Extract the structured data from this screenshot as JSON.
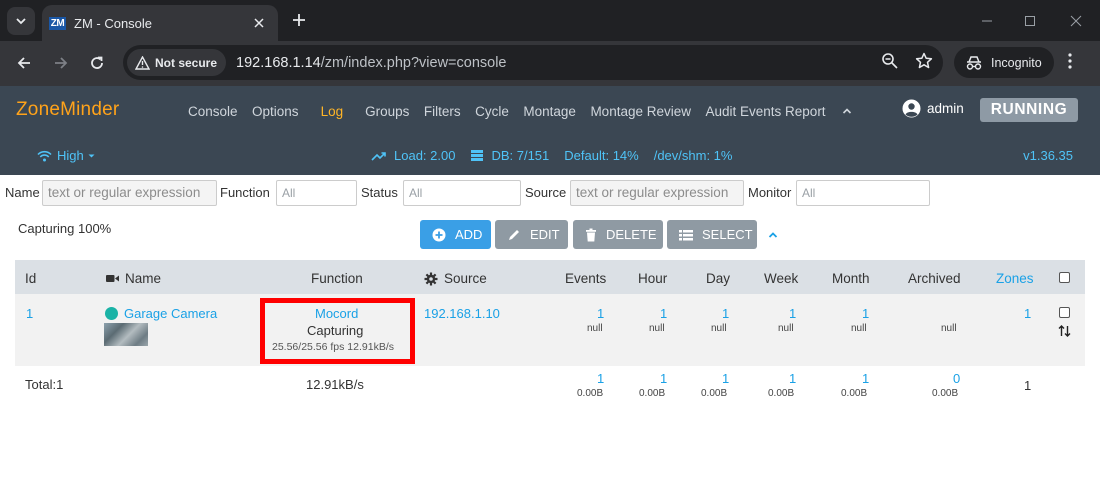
{
  "browser": {
    "tab_title": "ZM - Console",
    "favicon_text": "ZM",
    "security_chip": "Not secure",
    "url_host": "192.168.1.14",
    "url_path": "/zm/index.php?view=console",
    "profile_label": "Incognito"
  },
  "app": {
    "brand": "ZoneMinder",
    "menu": [
      {
        "label": "Console"
      },
      {
        "label": "Options"
      },
      {
        "label": "Log"
      },
      {
        "label": "Groups"
      },
      {
        "label": "Filters"
      },
      {
        "label": "Cycle"
      },
      {
        "label": "Montage"
      },
      {
        "label": "Montage Review"
      },
      {
        "label": "Audit Events Report"
      }
    ],
    "active_menu": "Log",
    "user": "admin",
    "state": "RUNNING",
    "bandwidth": "High",
    "load": "Load: 2.00",
    "db": "DB: 7/151",
    "storage": "Default: 14%",
    "shm": "/dev/shm: 1%",
    "version": "v1.36.35"
  },
  "filters": {
    "name_label": "Name",
    "name_placeholder": "text or regular expression",
    "function_label": "Function",
    "function_value": "All",
    "status_label": "Status",
    "status_value": "All",
    "source_label": "Source",
    "source_placeholder": "text or regular expression",
    "monitor_label": "Monitor",
    "monitor_value": "All"
  },
  "actions": {
    "capturing_summary": "Capturing 100%",
    "add": "ADD",
    "edit": "EDIT",
    "delete": "DELETE",
    "select": "SELECT"
  },
  "table": {
    "headers": {
      "id": "Id",
      "name": "Name",
      "function": "Function",
      "source": "Source",
      "events": "Events",
      "hour": "Hour",
      "day": "Day",
      "week": "Week",
      "month": "Month",
      "archived": "Archived",
      "zones": "Zones"
    },
    "rows": [
      {
        "id": "1",
        "name": "Garage Camera",
        "function": "Mocord",
        "status": "Capturing",
        "fps": "25.56/25.56 fps 12.91kB/s",
        "source": "192.168.1.10",
        "events": "1",
        "events_size": "null",
        "hour": "1",
        "hour_size": "null",
        "day": "1",
        "day_size": "null",
        "week": "1",
        "week_size": "null",
        "month": "1",
        "month_size": "null",
        "archived_size": "null",
        "zones": "1"
      }
    ],
    "totals": {
      "label": "Total:1",
      "bandwidth": "12.91kB/s",
      "events": "1",
      "events_size": "0.00B",
      "hour": "1",
      "hour_size": "0.00B",
      "day": "1",
      "day_size": "0.00B",
      "week": "1",
      "week_size": "0.00B",
      "month": "1",
      "month_size": "0.00B",
      "archived": "0",
      "archived_size": "0.00B",
      "zones": "1"
    }
  },
  "colors": {
    "navbar": "#3b4753",
    "brand": "#ffa31a",
    "active_menu": "#ffb527",
    "link": "#1aa1e6",
    "add_button": "#3a9fe6",
    "disabled_button": "#8f9aa3",
    "highlight_box": "#ff0000"
  }
}
